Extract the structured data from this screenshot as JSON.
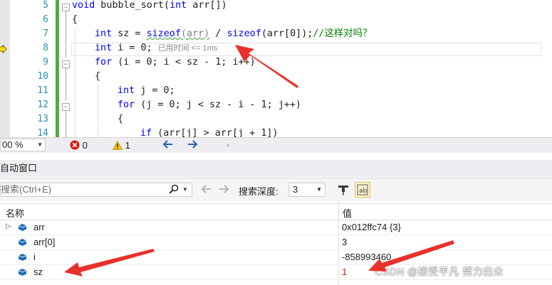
{
  "editor": {
    "lines": [
      {
        "num": "5"
      },
      {
        "num": "6"
      },
      {
        "num": "7"
      },
      {
        "num": "8"
      },
      {
        "num": "9"
      },
      {
        "num": "10"
      },
      {
        "num": "11"
      },
      {
        "num": "12"
      },
      {
        "num": "13"
      },
      {
        "num": "14"
      }
    ],
    "code": {
      "l5_kw": "void",
      "l5_rest": " bubble_sort(",
      "l5_int": "int",
      "l5_param": " arr[])",
      "l6": "{",
      "l7_int": "int",
      "l7_sz": " sz = ",
      "l7_sizeof": "sizeof",
      "l7_arg": "(arr)",
      "l7_div": " / ",
      "l7_sizeof2": "sizeof",
      "l7_arg2": "(arr[0]);",
      "l7_comment": "//这样对吗？",
      "l8_int": "int",
      "l8_rest": " i = 0;",
      "l8_elapsed": "已用时间 <= 1ms",
      "l9_for": "for",
      "l9_rest": " (i = 0; i < sz - 1; i++)",
      "l10": "{",
      "l11_int": "int",
      "l11_rest": " j = 0;",
      "l12_for": "for",
      "l12_rest": " (j = 0; j < sz - i - 1; j++)",
      "l13": "{",
      "l14_if": "if",
      "l14_rest": " (arr[j] > arr[j + 1])"
    }
  },
  "status_bar": {
    "zoom": "00 %",
    "errors": "0",
    "warnings": "1"
  },
  "autos": {
    "title": "自动窗口",
    "search_placeholder": "搜索(Ctrl+E)",
    "depth_label": "搜索深度:",
    "depth_value": "3",
    "col_name": "名称",
    "col_value": "值",
    "rows": [
      {
        "name": "arr",
        "value": "0x012ffc74 {3}",
        "changed": false,
        "expandable": true
      },
      {
        "name": "arr[0]",
        "value": "3",
        "changed": false,
        "expandable": false
      },
      {
        "name": "i",
        "value": "-858993460",
        "changed": false,
        "expandable": false
      },
      {
        "name": "sz",
        "value": "1",
        "changed": true,
        "expandable": false
      }
    ]
  },
  "watermark": "CSDN @接受平凡 努力出众",
  "colors": {
    "keyword": "#0000ff",
    "comment": "#008000",
    "line_number": "#2b91af",
    "changed_value": "#e51400",
    "annotation_arrow": "#e8312a",
    "change_bar": "#57a64a"
  }
}
